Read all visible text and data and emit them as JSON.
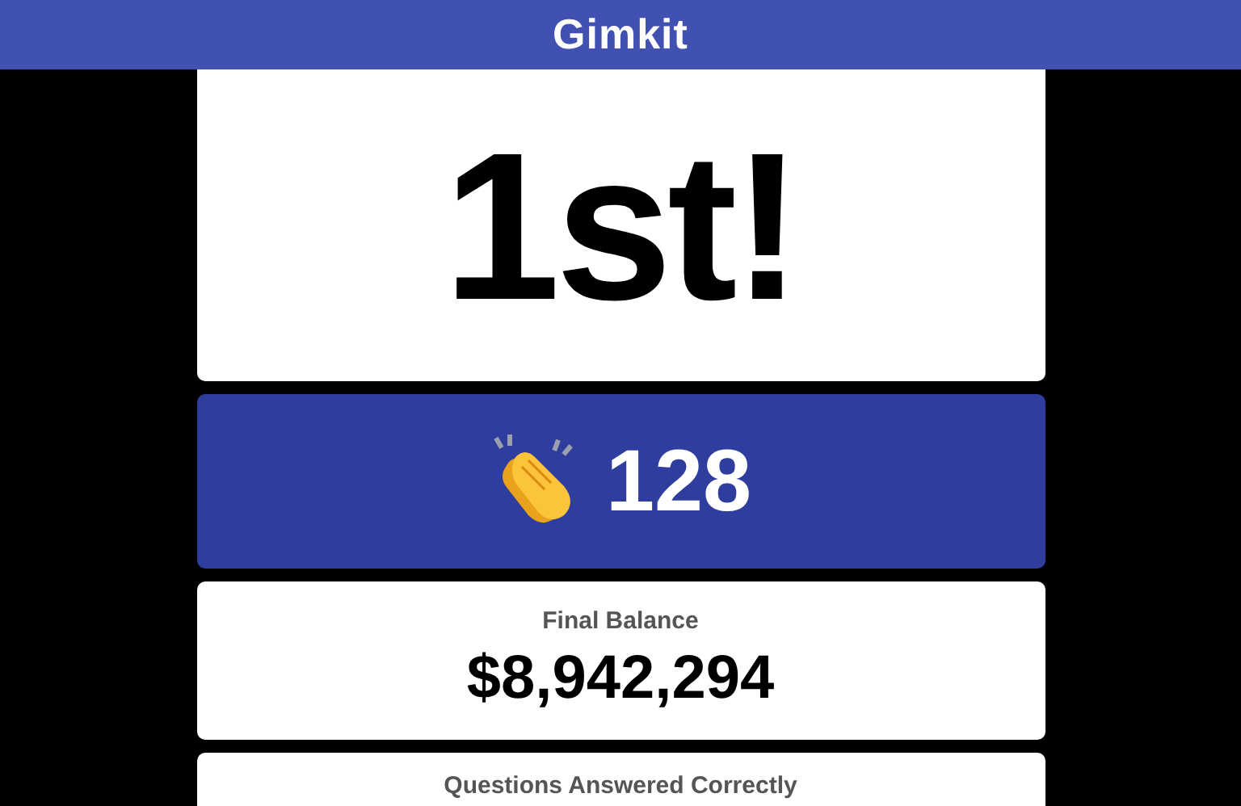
{
  "header": {
    "title": "Gimkit"
  },
  "placement": {
    "text": "1st!"
  },
  "streak": {
    "count": "128"
  },
  "stats": [
    {
      "label": "Final Balance",
      "value": "$8,942,294"
    },
    {
      "label": "Questions Answered Correctly"
    }
  ]
}
